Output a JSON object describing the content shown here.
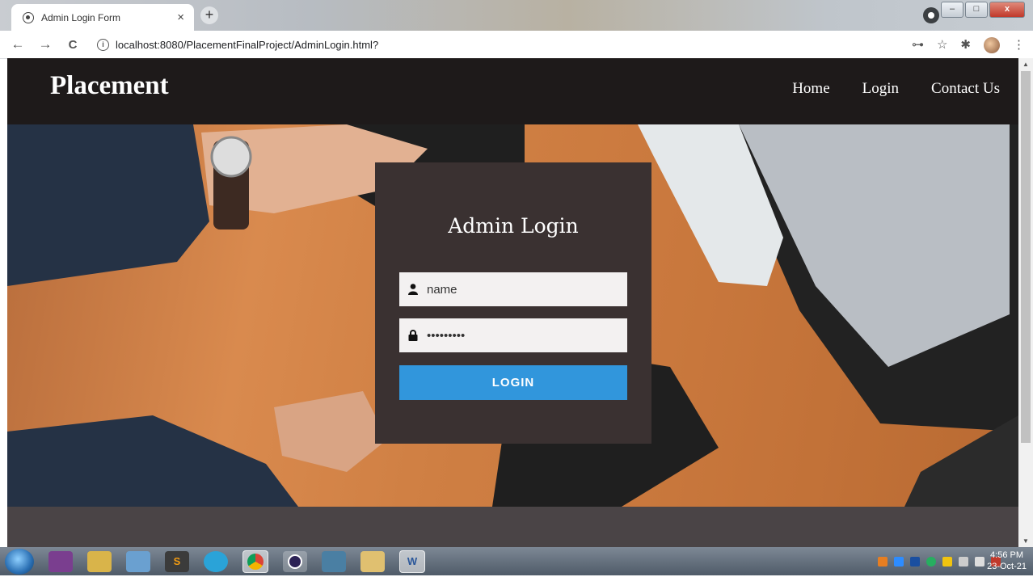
{
  "browser": {
    "tab_title": "Admin Login Form",
    "tab_close": "×",
    "new_tab": "+",
    "url": "localhost:8080/PlacementFinalProject/AdminLogin.html?",
    "back": "←",
    "forward": "→",
    "reload": "C",
    "info": "i",
    "key": "⊶",
    "star": "☆",
    "extensions": "✱",
    "menu": "⋮",
    "minimize": "–",
    "maximize": "□",
    "close": "x"
  },
  "site": {
    "brand": "Placement",
    "nav": [
      "Home",
      "Login",
      "Contact Us"
    ]
  },
  "login": {
    "title": "Admin Login",
    "username_value": "name",
    "password_value": "•••••••••",
    "button_label": "LOGIN"
  },
  "taskbar": {
    "time": "4:56 PM",
    "date": "23-Oct-21"
  },
  "colors": {
    "header_bg": "#1e1a1a",
    "login_box_bg": "#3a3131",
    "button_bg": "#3196dc",
    "footer_bg": "#4a4446"
  }
}
